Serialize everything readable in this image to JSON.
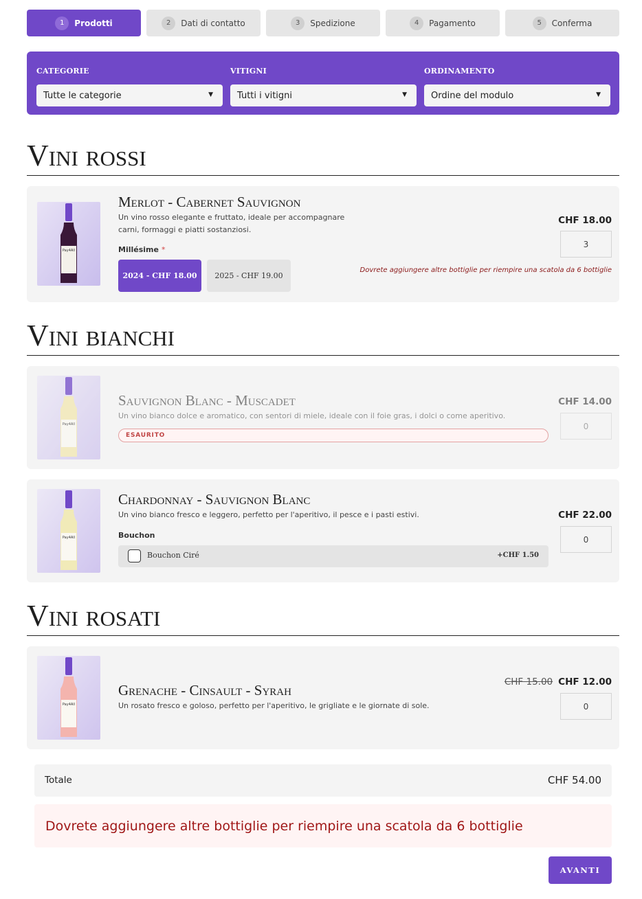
{
  "steps": [
    {
      "num": "1",
      "label": "Prodotti"
    },
    {
      "num": "2",
      "label": "Dati di contatto"
    },
    {
      "num": "3",
      "label": "Spedizione"
    },
    {
      "num": "4",
      "label": "Pagamento"
    },
    {
      "num": "5",
      "label": "Conferma"
    }
  ],
  "filters": {
    "category_label": "CATEGORIE",
    "category_value": "Tutte le categorie",
    "grape_label": "VITIGNI",
    "grape_value": "Tutti i vitigni",
    "sort_label": "ORDINAMENTO",
    "sort_value": "Ordine del modulo",
    "arrow": "▼"
  },
  "sections": {
    "red": "Vini rossi",
    "white": "Vini bianchi",
    "rose": "Vini rosati"
  },
  "products": {
    "merlot": {
      "name": "Merlot - Cabernet Sauvignon",
      "desc": "Un vino rosso elegante e fruttato, ideale per accompagnare carni, formaggi e piatti sostanziosi.",
      "price": "CHF 18.00",
      "qty": "3",
      "option_label": "Millésime",
      "required_mark": "*",
      "variants": [
        "2024  -  CHF 18.00",
        "2025  -  CHF 19.00"
      ],
      "warning": "Dovrete aggiungere altre bottiglie per riempire una scatola da 6 bottiglie",
      "wine_color": "#3a1838"
    },
    "sauvignon": {
      "name": "Sauvignon Blanc - Muscadet",
      "desc": "Un vino bianco dolce e aromatico, con sentori di miele, ideale con il foie gras, i dolci o come aperitivo.",
      "price": "CHF 14.00",
      "qty": "0",
      "badge": "ESAURITO",
      "wine_color": "#f2e7b0"
    },
    "chardonnay": {
      "name": "Chardonnay - Sauvignon Blanc",
      "desc": "Un vino bianco fresco e leggero, perfetto per l'aperitivo, il pesce e i pasti estivi.",
      "price": "CHF 22.00",
      "qty": "0",
      "option_label": "Bouchon",
      "addon_label": "Bouchon Ciré",
      "addon_price": "+CHF 1.50",
      "wine_color": "#f1eab8"
    },
    "grenache": {
      "name": "Grenache - Cinsault - Syrah",
      "desc": "Un rosato fresco e goloso, perfetto per l'aperitivo, le grigliate e le giornate di sole.",
      "old_price": "CHF 15.00",
      "price": "CHF 12.00",
      "qty": "0",
      "wine_color": "#f4b4ae"
    }
  },
  "summary": {
    "total_label": "Totale",
    "total_value": "CHF 54.00",
    "alert": "Dovrete aggiungere altre bottiglie per riempire una scatola da 6 bottiglie",
    "next_label": "AVANTI"
  },
  "colors": {
    "accent": "#7048c8",
    "panel": "#f4f4f4",
    "alert_text": "#a01818"
  }
}
